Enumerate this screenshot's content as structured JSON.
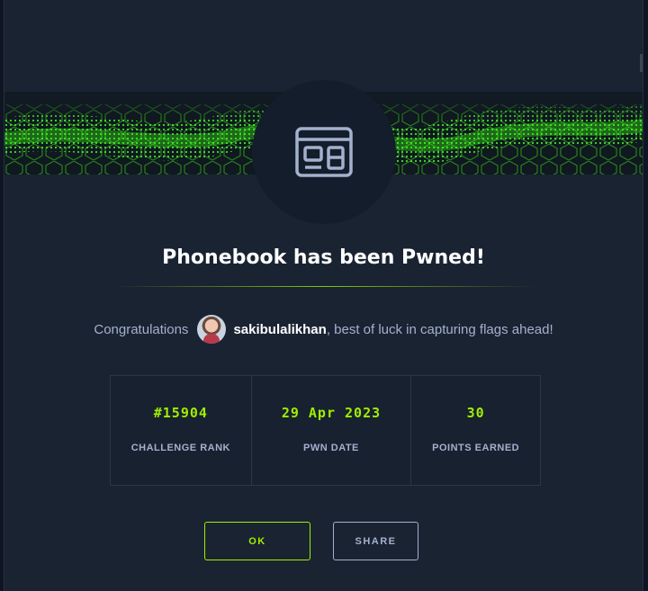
{
  "modal": {
    "title": "Phonebook has been Pwned!",
    "icon": "web-challenge-icon",
    "accent_color": "#9fef00"
  },
  "message": {
    "prefix": "Congratulations",
    "username": "sakibulalikhan",
    "suffix": ", best of luck in capturing flags ahead!"
  },
  "stats": [
    {
      "value": "#15904",
      "label": "CHALLENGE RANK"
    },
    {
      "value": "29 Apr 2023",
      "label": "PWN DATE"
    },
    {
      "value": "30",
      "label": "POINTS EARNED"
    }
  ],
  "buttons": {
    "ok_label": "OK",
    "share_label": "SHARE"
  }
}
